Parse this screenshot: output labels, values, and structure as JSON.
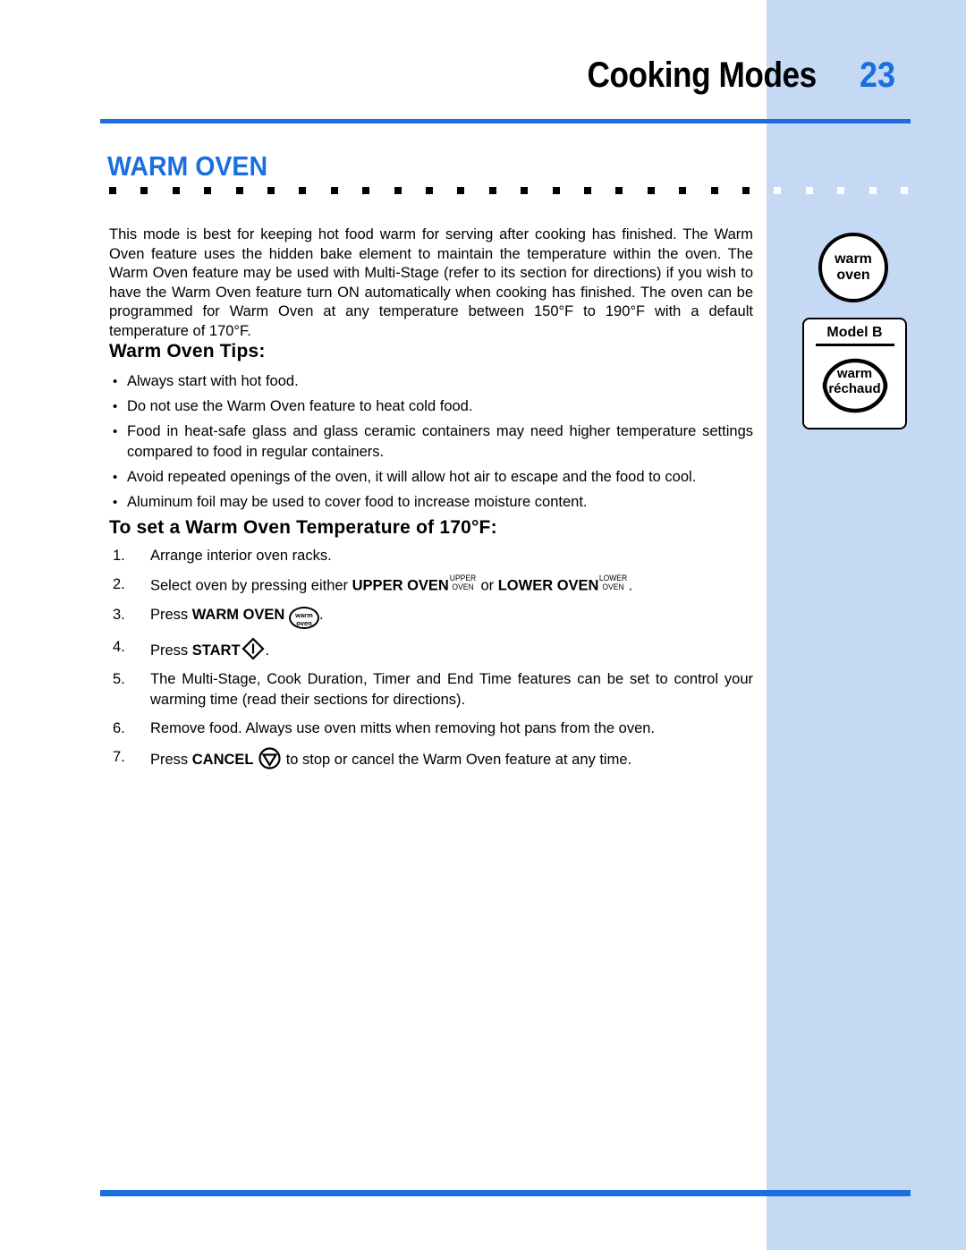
{
  "header": {
    "title": "Cooking Modes",
    "page_number": "23",
    "rule_color": "#1a6ee0"
  },
  "section": {
    "title": "WARM OVEN",
    "title_color": "#1a6ee0",
    "band_color": "#c5d9f5"
  },
  "intro": "This mode is best for keeping hot food warm for serving after cooking has finished. The Warm Oven feature uses the hidden bake element to maintain the temperature within the oven. The Warm Oven feature may be used with Multi-Stage (refer to its section for directions) if you wish to have the Warm Oven feature turn ON automatically when cooking has finished. The oven can be programmed for Warm Oven at any temperature between 150°F to 190°F with a default temperature of 170°F.",
  "tips": {
    "heading": "Warm Oven Tips:",
    "items": [
      "Always start with hot food.",
      "Do not use the Warm Oven feature to heat cold food.",
      "Food in heat-safe glass and glass ceramic containers may need higher temperature settings compared to food in regular containers.",
      "Avoid repeated openings of the oven, it will allow hot air to escape and the food to cool.",
      "Aluminum foil may be used to cover food to increase moisture content."
    ]
  },
  "procedure": {
    "heading": "To set a Warm Oven Temperature of 170°F:",
    "steps": [
      {
        "number": "1.",
        "text_before": "Arrange interior oven racks.",
        "text_after": ""
      },
      {
        "number": "2.",
        "text_before": "Select oven by pressing either ",
        "bold1": "UPPER OVEN",
        "key1_line1": "UPPER",
        "key1_line2": "OVEN",
        "mid": " or ",
        "bold2": "LOWER OVEN",
        "key2_line1": "LOWER",
        "key2_line2": "OVEN",
        "text_after": "."
      },
      {
        "number": "3.",
        "text_before": "Press ",
        "bold1": "WARM OVEN",
        "key_line1": "warm",
        "key_line2": "oven",
        "text_after": "."
      },
      {
        "number": "4.",
        "text_before": "Press ",
        "bold1": "START",
        "key_icon": "start-diamond-icon",
        "text_after": "."
      },
      {
        "number": "5.",
        "text_before": "The Multi-Stage, Cook Duration, Timer and End Time features can be set to control your warming time (read their sections for directions).",
        "text_after": ""
      },
      {
        "number": "6.",
        "text_before": "Remove food. Always use oven mitts when removing hot pans from the oven.",
        "text_after": ""
      },
      {
        "number": "7.",
        "text_before": "Press ",
        "bold1": "CANCEL",
        "key_icon": "cancel-triangle-icon",
        "text_after": " to stop or cancel the Warm Oven feature at any time."
      }
    ]
  },
  "sidebar": {
    "warm_button": {
      "line1": "warm",
      "line2": "oven"
    },
    "model_box": {
      "label": "Model B",
      "button_line1": "warm",
      "button_line2": "réchaud"
    }
  }
}
